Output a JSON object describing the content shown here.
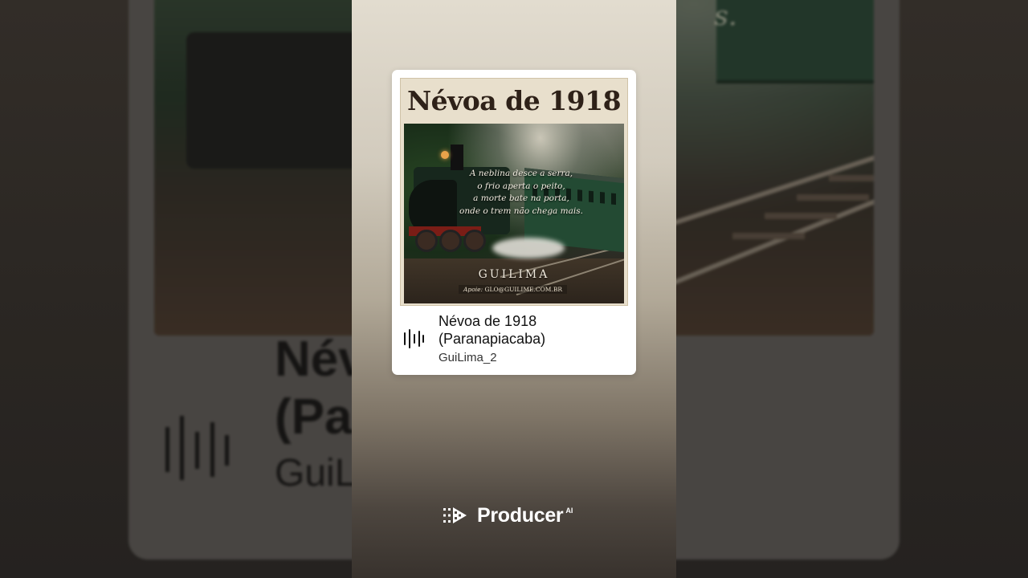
{
  "song": {
    "title_line1": "Névoa de 1918",
    "title_line2": "(Paranapiacaba)",
    "artist": "GuiLima_2"
  },
  "cover": {
    "title": "Névoa de 1918",
    "poem": [
      "A neblina desce a serra,",
      "o frio aperta o peito,",
      "a morte bate na porta,",
      "onde o trem não chega mais."
    ],
    "artist": "GUILIMA",
    "support_label": "Apoie:",
    "support_contact": "GLO@GUILIME.COM.BR"
  },
  "background": {
    "title_partial": "Név\n(Pa",
    "artist_partial": "GuiL",
    "text_partial": "or                                      s."
  },
  "brand": {
    "name": "Producer",
    "superscript": "AI",
    "logo_icon": "producer-logo-icon"
  },
  "icons": {
    "waveform": "waveform-icon"
  },
  "colors": {
    "card_bg": "#ffffff",
    "brand_text": "#ffffff",
    "cover_title": "#2e2118"
  }
}
